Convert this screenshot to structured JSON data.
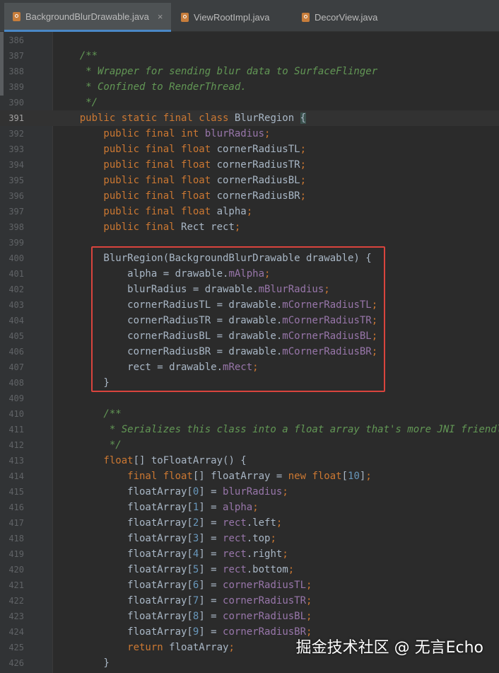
{
  "tabs": [
    {
      "label": "BackgroundBlurDrawable.java",
      "active": true,
      "close": "×"
    },
    {
      "label": "ViewRootImpl.java",
      "active": false
    },
    {
      "label": "DecorView.java",
      "active": false
    }
  ],
  "current_line": "391",
  "lines": [
    {
      "n": "386",
      "tokens": []
    },
    {
      "n": "387",
      "tokens": [
        [
          "cm",
          "    /**"
        ]
      ]
    },
    {
      "n": "388",
      "tokens": [
        [
          "cm",
          "     * Wrapper for sending blur data to SurfaceFlinger"
        ]
      ]
    },
    {
      "n": "389",
      "tokens": [
        [
          "cm",
          "     * Confined to RenderThread."
        ]
      ]
    },
    {
      "n": "390",
      "tokens": [
        [
          "cm",
          "     */"
        ]
      ]
    },
    {
      "n": "391",
      "tokens": [
        [
          "kw",
          "    public static final class "
        ],
        [
          "pln",
          "BlurRegion "
        ],
        [
          "brk",
          "{"
        ]
      ]
    },
    {
      "n": "392",
      "tokens": [
        [
          "kw",
          "        public final int "
        ],
        [
          "fld",
          "blurRadius"
        ],
        [
          "kw",
          ";"
        ]
      ]
    },
    {
      "n": "393",
      "tokens": [
        [
          "kw",
          "        public final float "
        ],
        [
          "pln",
          "cornerRadiusTL"
        ],
        [
          "kw",
          ";"
        ]
      ]
    },
    {
      "n": "394",
      "tokens": [
        [
          "kw",
          "        public final float "
        ],
        [
          "pln",
          "cornerRadiusTR"
        ],
        [
          "kw",
          ";"
        ]
      ]
    },
    {
      "n": "395",
      "tokens": [
        [
          "kw",
          "        public final float "
        ],
        [
          "pln",
          "cornerRadiusBL"
        ],
        [
          "kw",
          ";"
        ]
      ]
    },
    {
      "n": "396",
      "tokens": [
        [
          "kw",
          "        public final float "
        ],
        [
          "pln",
          "cornerRadiusBR"
        ],
        [
          "kw",
          ";"
        ]
      ]
    },
    {
      "n": "397",
      "tokens": [
        [
          "kw",
          "        public final float "
        ],
        [
          "pln",
          "alpha"
        ],
        [
          "kw",
          ";"
        ]
      ]
    },
    {
      "n": "398",
      "tokens": [
        [
          "kw",
          "        public final "
        ],
        [
          "pln",
          "Rect rect"
        ],
        [
          "kw",
          ";"
        ]
      ]
    },
    {
      "n": "399",
      "tokens": []
    },
    {
      "n": "400",
      "tokens": [
        [
          "pln",
          "        BlurRegion(BackgroundBlurDrawable drawable) {"
        ]
      ]
    },
    {
      "n": "401",
      "tokens": [
        [
          "pln",
          "            alpha = drawable."
        ],
        [
          "fld",
          "mAlpha"
        ],
        [
          "kw",
          ";"
        ]
      ]
    },
    {
      "n": "402",
      "tokens": [
        [
          "pln",
          "            blurRadius = drawable."
        ],
        [
          "fld",
          "mBlurRadius"
        ],
        [
          "kw",
          ";"
        ]
      ]
    },
    {
      "n": "403",
      "tokens": [
        [
          "pln",
          "            cornerRadiusTL = drawable."
        ],
        [
          "fld",
          "mCornerRadiusTL"
        ],
        [
          "kw",
          ";"
        ]
      ]
    },
    {
      "n": "404",
      "tokens": [
        [
          "pln",
          "            cornerRadiusTR = drawable."
        ],
        [
          "fld",
          "mCornerRadiusTR"
        ],
        [
          "kw",
          ";"
        ]
      ]
    },
    {
      "n": "405",
      "tokens": [
        [
          "pln",
          "            cornerRadiusBL = drawable."
        ],
        [
          "fld",
          "mCornerRadiusBL"
        ],
        [
          "kw",
          ";"
        ]
      ]
    },
    {
      "n": "406",
      "tokens": [
        [
          "pln",
          "            cornerRadiusBR = drawable."
        ],
        [
          "fld",
          "mCornerRadiusBR"
        ],
        [
          "kw",
          ";"
        ]
      ]
    },
    {
      "n": "407",
      "tokens": [
        [
          "pln",
          "            rect = drawable."
        ],
        [
          "fld",
          "mRect"
        ],
        [
          "kw",
          ";"
        ]
      ]
    },
    {
      "n": "408",
      "tokens": [
        [
          "pln",
          "        }"
        ]
      ]
    },
    {
      "n": "409",
      "tokens": []
    },
    {
      "n": "410",
      "tokens": [
        [
          "cm",
          "        /**"
        ]
      ]
    },
    {
      "n": "411",
      "tokens": [
        [
          "cm",
          "         * Serializes this class into a float array that's more JNI friendly."
        ]
      ]
    },
    {
      "n": "412",
      "tokens": [
        [
          "cm",
          "         */"
        ]
      ]
    },
    {
      "n": "413",
      "tokens": [
        [
          "kw",
          "        float"
        ],
        [
          "pln",
          "[] toFloatArray() {"
        ]
      ]
    },
    {
      "n": "414",
      "tokens": [
        [
          "kw",
          "            final float"
        ],
        [
          "pln",
          "[] floatArray = "
        ],
        [
          "kw",
          "new float"
        ],
        [
          "pln",
          "["
        ],
        [
          "num",
          "10"
        ],
        [
          "pln",
          "]"
        ],
        [
          "kw",
          ";"
        ]
      ]
    },
    {
      "n": "415",
      "tokens": [
        [
          "pln",
          "            floatArray["
        ],
        [
          "num",
          "0"
        ],
        [
          "pln",
          "] = "
        ],
        [
          "fld",
          "blurRadius"
        ],
        [
          "kw",
          ";"
        ]
      ]
    },
    {
      "n": "416",
      "tokens": [
        [
          "pln",
          "            floatArray["
        ],
        [
          "num",
          "1"
        ],
        [
          "pln",
          "] = "
        ],
        [
          "fld",
          "alpha"
        ],
        [
          "kw",
          ";"
        ]
      ]
    },
    {
      "n": "417",
      "tokens": [
        [
          "pln",
          "            floatArray["
        ],
        [
          "num",
          "2"
        ],
        [
          "pln",
          "] = "
        ],
        [
          "fld",
          "rect"
        ],
        [
          "pln",
          ".left"
        ],
        [
          "kw",
          ";"
        ]
      ]
    },
    {
      "n": "418",
      "tokens": [
        [
          "pln",
          "            floatArray["
        ],
        [
          "num",
          "3"
        ],
        [
          "pln",
          "] = "
        ],
        [
          "fld",
          "rect"
        ],
        [
          "pln",
          ".top"
        ],
        [
          "kw",
          ";"
        ]
      ]
    },
    {
      "n": "419",
      "tokens": [
        [
          "pln",
          "            floatArray["
        ],
        [
          "num",
          "4"
        ],
        [
          "pln",
          "] = "
        ],
        [
          "fld",
          "rect"
        ],
        [
          "pln",
          ".right"
        ],
        [
          "kw",
          ";"
        ]
      ]
    },
    {
      "n": "420",
      "tokens": [
        [
          "pln",
          "            floatArray["
        ],
        [
          "num",
          "5"
        ],
        [
          "pln",
          "] = "
        ],
        [
          "fld",
          "rect"
        ],
        [
          "pln",
          ".bottom"
        ],
        [
          "kw",
          ";"
        ]
      ]
    },
    {
      "n": "421",
      "tokens": [
        [
          "pln",
          "            floatArray["
        ],
        [
          "num",
          "6"
        ],
        [
          "pln",
          "] = "
        ],
        [
          "fld",
          "cornerRadiusTL"
        ],
        [
          "kw",
          ";"
        ]
      ]
    },
    {
      "n": "422",
      "tokens": [
        [
          "pln",
          "            floatArray["
        ],
        [
          "num",
          "7"
        ],
        [
          "pln",
          "] = "
        ],
        [
          "fld",
          "cornerRadiusTR"
        ],
        [
          "kw",
          ";"
        ]
      ]
    },
    {
      "n": "423",
      "tokens": [
        [
          "pln",
          "            floatArray["
        ],
        [
          "num",
          "8"
        ],
        [
          "pln",
          "] = "
        ],
        [
          "fld",
          "cornerRadiusBL"
        ],
        [
          "kw",
          ";"
        ]
      ]
    },
    {
      "n": "424",
      "tokens": [
        [
          "pln",
          "            floatArray["
        ],
        [
          "num",
          "9"
        ],
        [
          "pln",
          "] = "
        ],
        [
          "fld",
          "cornerRadiusBR"
        ],
        [
          "kw",
          ";"
        ]
      ]
    },
    {
      "n": "425",
      "tokens": [
        [
          "kw",
          "            return "
        ],
        [
          "pln",
          "floatArray"
        ],
        [
          "kw",
          ";"
        ]
      ]
    },
    {
      "n": "426",
      "tokens": [
        [
          "pln",
          "        }"
        ]
      ]
    }
  ],
  "watermark": "掘金技术社区 @ 无言Echo",
  "colors": {
    "background": "#2b2b2b",
    "keyword": "#cc7832",
    "comment": "#629755",
    "field": "#9876aa",
    "number": "#6897bb",
    "text": "#a9b7c6",
    "highlight_box": "#d9443d"
  }
}
